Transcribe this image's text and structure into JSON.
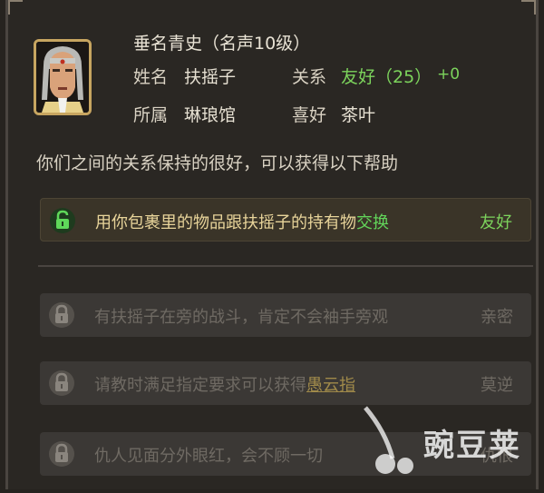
{
  "npc": {
    "title": "垂名青史（名声10级）",
    "name_label": "姓名",
    "name_value": "扶摇子",
    "relation_label": "关系",
    "relation_value": "友好（25）",
    "relation_delta": "+0",
    "faction_label": "所属",
    "faction_value": "琳琅馆",
    "hobby_label": "喜好",
    "hobby_value": "茶叶"
  },
  "intro": "你们之间的关系保持的很好，可以获得以下帮助",
  "perks": [
    {
      "text_pre": "用你包裹里的物品跟扶摇子的持有物",
      "text_hl": "交换",
      "level": "友好",
      "unlocked": true
    },
    {
      "text_pre": "有扶摇子在旁的战斗，肯定不会袖手旁观",
      "level": "亲密",
      "unlocked": false
    },
    {
      "text_pre": "请教时满足指定要求可以获得",
      "text_link": "愚云指",
      "level": "莫逆",
      "unlocked": false
    },
    {
      "text_pre": "仇人见面分外眼红，会不顾一切",
      "level": "仇恨",
      "unlocked": false
    }
  ],
  "watermark": "豌豆荚",
  "colors": {
    "background": "#2a2723",
    "friendly_green": "#7cd35c",
    "gold": "#c7a560"
  }
}
